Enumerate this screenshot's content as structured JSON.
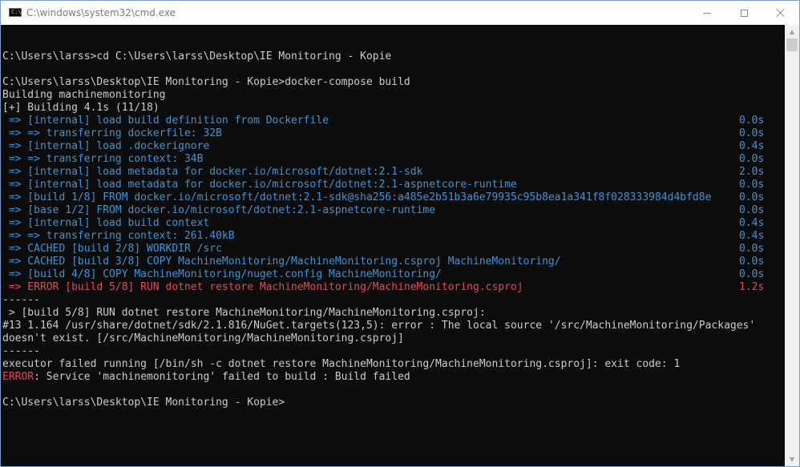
{
  "window": {
    "title": "C:\\windows\\system32\\cmd.exe",
    "app_icon": "cmd-prompt-icon",
    "app_icon_glyph": "C:\\",
    "controls": {
      "minimize_icon": "minimize-icon",
      "maximize_icon": "maximize-icon",
      "close_icon": "close-icon"
    }
  },
  "colors": {
    "console_bg": "#0c0c0c",
    "text": "#cccccc",
    "info_blue": "#3a96dd",
    "error_red": "#e74856"
  },
  "console": {
    "lines": [
      {
        "text": "",
        "time": "",
        "color": "default"
      },
      {
        "text": "C:\\Users\\larss>cd C:\\Users\\larss\\Desktop\\IE Monitoring - Kopie",
        "time": "",
        "color": "default"
      },
      {
        "text": "",
        "time": "",
        "color": "default"
      },
      {
        "text": "C:\\Users\\larss\\Desktop\\IE Monitoring - Kopie>docker-compose build",
        "time": "",
        "color": "default"
      },
      {
        "text": "Building machinemonitoring",
        "time": "",
        "color": "default"
      },
      {
        "text": "[+] Building 4.1s (11/18)",
        "time": "",
        "color": "default"
      },
      {
        "text": " => [internal] load build definition from Dockerfile",
        "time": "0.0s",
        "color": "blue"
      },
      {
        "text": " => => transferring dockerfile: 32B",
        "time": "0.0s",
        "color": "blue"
      },
      {
        "text": " => [internal] load .dockerignore",
        "time": "0.4s",
        "color": "blue"
      },
      {
        "text": " => => transferring context: 34B",
        "time": "0.0s",
        "color": "blue"
      },
      {
        "text": " => [internal] load metadata for docker.io/microsoft/dotnet:2.1-sdk",
        "time": "2.0s",
        "color": "blue"
      },
      {
        "text": " => [internal] load metadata for docker.io/microsoft/dotnet:2.1-aspnetcore-runtime",
        "time": "0.0s",
        "color": "blue"
      },
      {
        "text": " => [build 1/8] FROM docker.io/microsoft/dotnet:2.1-sdk@sha256:a485e2b51b3a6e79935c95b8ea1a341f8f028333984d4bfd8e",
        "time": "0.0s",
        "color": "blue"
      },
      {
        "text": " => [base 1/2] FROM docker.io/microsoft/dotnet:2.1-aspnetcore-runtime",
        "time": "0.0s",
        "color": "blue"
      },
      {
        "text": " => [internal] load build context",
        "time": "0.4s",
        "color": "blue"
      },
      {
        "text": " => => transferring context: 261.40kB",
        "time": "0.4s",
        "color": "blue"
      },
      {
        "text": " => CACHED [build 2/8] WORKDIR /src",
        "time": "0.0s",
        "color": "blue"
      },
      {
        "text": " => CACHED [build 3/8] COPY MachineMonitoring/MachineMonitoring.csproj MachineMonitoring/",
        "time": "0.0s",
        "color": "blue"
      },
      {
        "text": " => [build 4/8] COPY MachineMonitoring/nuget.config MachineMonitoring/",
        "time": "0.0s",
        "color": "blue"
      },
      {
        "text": " => ERROR [build 5/8] RUN dotnet restore MachineMonitoring/MachineMonitoring.csproj",
        "time": "1.2s",
        "color": "red"
      },
      {
        "text": "------",
        "time": "",
        "color": "default"
      },
      {
        "text": " > [build 5/8] RUN dotnet restore MachineMonitoring/MachineMonitoring.csproj:",
        "time": "",
        "color": "default"
      },
      {
        "text": "#13 1.164 /usr/share/dotnet/sdk/2.1.816/NuGet.targets(123,5): error : The local source '/src/MachineMonitoring/Packages'",
        "time": "",
        "color": "default"
      },
      {
        "text": "doesn't exist. [/src/MachineMonitoring/MachineMonitoring.csproj]",
        "time": "",
        "color": "default"
      },
      {
        "text": "------",
        "time": "",
        "color": "default"
      },
      {
        "text": "executor failed running [/bin/sh -c dotnet restore MachineMonitoring/MachineMonitoring.csproj]: exit code: 1",
        "time": "",
        "color": "default"
      },
      {
        "text": ": Service 'machinemonitoring' failed to build : Build failed",
        "prefix": "ERROR",
        "time": "",
        "color": "default"
      },
      {
        "text": "",
        "time": "",
        "color": "default"
      },
      {
        "text": "C:\\Users\\larss\\Desktop\\IE Monitoring - Kopie>",
        "time": "",
        "color": "default"
      }
    ]
  },
  "scrollbar": {
    "up_icon": "scroll-up-arrow-icon",
    "down_icon": "scroll-down-arrow-icon",
    "up_glyph": "▲",
    "down_glyph": "▼"
  }
}
